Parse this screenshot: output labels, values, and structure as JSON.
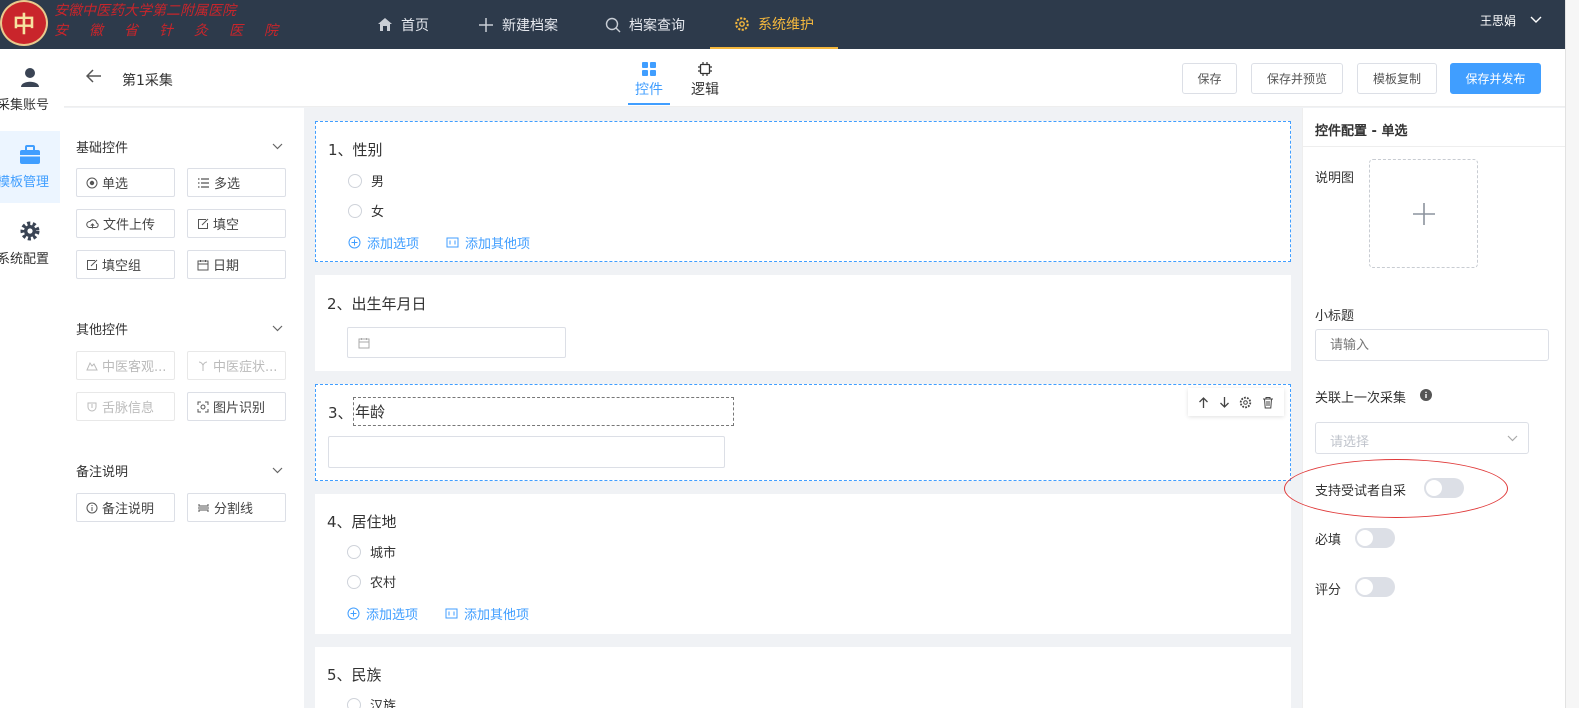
{
  "topbar": {
    "brand_line1": "安徽中医药大学第二附属医院",
    "brand_line2": "安徽省针灸医院",
    "nav": [
      "首页",
      "新建档案",
      "档案查询",
      "系统维护"
    ],
    "active_nav": "系统维护",
    "user": "王思娟",
    "accent": "#f5b83d"
  },
  "leftrail": {
    "items": [
      {
        "label": "采集账号",
        "icon": "user-icon"
      },
      {
        "label": "模板管理",
        "icon": "briefcase-icon"
      },
      {
        "label": "系统配置",
        "icon": "gear-icon"
      }
    ],
    "active": "模板管理"
  },
  "header": {
    "title": "第1采集",
    "tabs": [
      "控件",
      "逻辑"
    ],
    "active_tab": "控件",
    "buttons": [
      "保存",
      "保存并预览",
      "模板复制",
      "保存并发布"
    ]
  },
  "palette": {
    "basic_title": "基础控件",
    "basic": [
      "单选",
      "多选",
      "文件上传",
      "填空",
      "填空组",
      "日期"
    ],
    "other_title": "其他控件",
    "other": [
      "中医客观...",
      "中医症状...",
      "舌脉信息",
      "图片识别"
    ],
    "note_title": "备注说明",
    "note": [
      "备注说明",
      "分割线"
    ]
  },
  "canvas": {
    "questions": [
      {
        "title": "1、性别",
        "options": [
          "男",
          "女"
        ]
      },
      {
        "title": "2、出生年月日"
      },
      {
        "title": "3、",
        "edit_value": "年龄"
      },
      {
        "title": "4、居住地",
        "options": [
          "城市",
          "农村"
        ]
      },
      {
        "title": "5、民族",
        "options": [
          "汉族"
        ]
      }
    ],
    "add_option": "添加选项",
    "add_other": "添加其他项"
  },
  "rightpanel": {
    "title": "控件配置 - 单选",
    "desc_img_label": "说明图",
    "subtitle_label": "小标题",
    "subtitle_placeholder": "请输入",
    "link_label": "关联上一次采集",
    "link_placeholder": "请选择",
    "self_collect_label": "支持受试者自采",
    "required_label": "必填",
    "score_label": "评分",
    "switches": {
      "self_collect": false,
      "required": false,
      "score": false
    }
  }
}
